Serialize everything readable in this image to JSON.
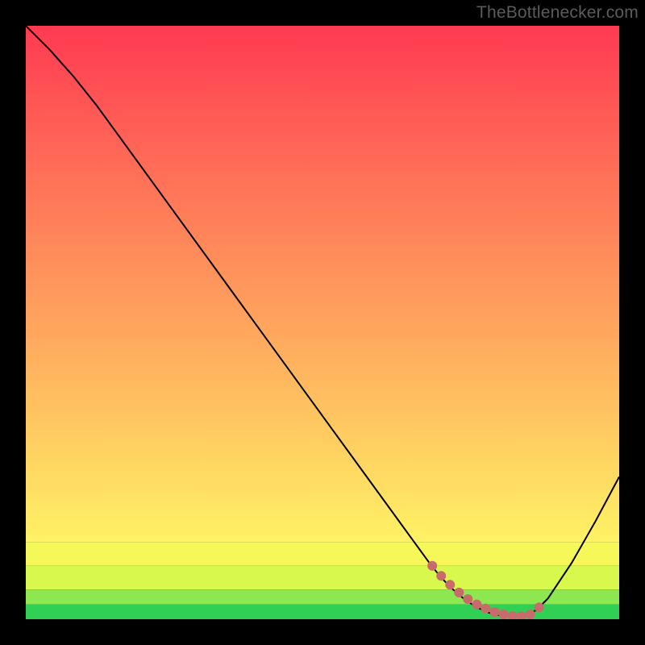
{
  "watermark": "TheBottlenecker.com",
  "chart_data": {
    "type": "line",
    "title": "",
    "xlabel": "",
    "ylabel": "",
    "xlim": [
      0,
      100
    ],
    "ylim": [
      0,
      100
    ],
    "series": [
      {
        "name": "curve",
        "x": [
          0,
          4,
          8,
          12,
          16,
          20,
          24,
          28,
          32,
          36,
          40,
          44,
          48,
          52,
          56,
          60,
          64,
          68,
          70,
          72,
          74,
          76,
          78,
          80,
          82,
          84,
          86,
          88,
          92,
          96,
          100
        ],
        "y": [
          100,
          96,
          91.5,
          86.5,
          81,
          75.5,
          70,
          64.5,
          59,
          53.5,
          48,
          42.5,
          37,
          31.5,
          26,
          20.5,
          15,
          9.5,
          7,
          5,
          3.3,
          2,
          1.1,
          0.6,
          0.45,
          0.6,
          1.5,
          3.5,
          9.5,
          16.5,
          24
        ],
        "color": "#000000",
        "width": 2
      },
      {
        "name": "dots",
        "type": "scatter",
        "x": [
          68.5,
          70,
          71.5,
          73,
          74.5,
          76,
          77.5,
          79,
          80.5,
          82,
          83.5,
          85,
          86.5
        ],
        "y": [
          9,
          7.3,
          5.8,
          4.5,
          3.4,
          2.5,
          1.8,
          1.2,
          0.8,
          0.55,
          0.5,
          0.8,
          2
        ],
        "color": "#c96b6b",
        "radius": 6
      }
    ],
    "bands": [
      {
        "from": 0,
        "to": 2.5,
        "color": "#2fd053"
      },
      {
        "from": 2.5,
        "to": 5,
        "color": "#8de751"
      },
      {
        "from": 5,
        "to": 9,
        "color": "#d8f84e"
      },
      {
        "from": 9,
        "to": 13,
        "color": "#f6f85a"
      },
      {
        "from": 13,
        "to": 100,
        "gradient": [
          "#fff265",
          "#ff3a52"
        ]
      }
    ]
  }
}
